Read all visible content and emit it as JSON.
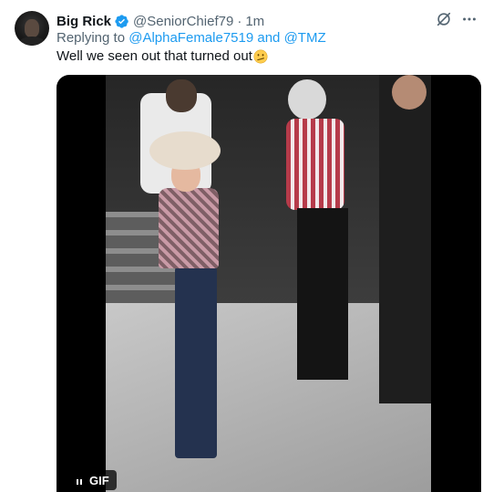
{
  "author": {
    "display_name": "Big Rick",
    "handle": "@SeniorChief79",
    "separator": "·",
    "time": "1m"
  },
  "reply": {
    "prefix": "Replying to",
    "mention_1": "@AlphaFemale7519",
    "joiner": "and",
    "mention_2": "@TMZ"
  },
  "tweet": {
    "text": "Well we seen out that turned out",
    "emoji": "🫤"
  },
  "media": {
    "badge_label": "GIF"
  },
  "icons": {
    "verified": "verified-badge-icon",
    "grok": "grok-icon",
    "more": "more-icon",
    "pause": "pause-icon"
  },
  "colors": {
    "text_primary": "#0f1419",
    "text_secondary": "#536471",
    "link": "#1d9bf0",
    "verified": "#1d9bf0"
  }
}
